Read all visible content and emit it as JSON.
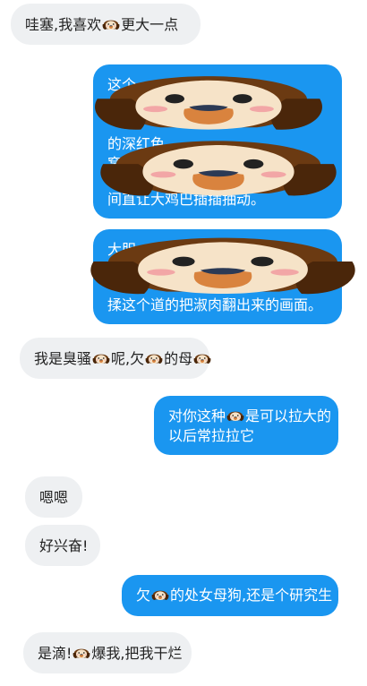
{
  "messages": [
    {
      "side": "left",
      "parts": [
        "哇塞,我喜欢",
        "更大一点"
      ]
    },
    {
      "side": "right",
      "lines": [
        "这个",
        "",
        "",
        "的深红色",
        "",
        "窝",
        "",
        "",
        "间直让大鸡巴插插抽动。"
      ]
    },
    {
      "side": "right",
      "lines": [
        "大胆",
        "",
        "",
        "揉这个道的把淑肉翻出来的画面。"
      ]
    },
    {
      "side": "left",
      "parts": [
        "我是臭骚",
        "呢,欠",
        "的母",
        ""
      ]
    },
    {
      "side": "right",
      "parts": [
        "对你这种",
        "是可以拉大的"
      ],
      "line2": "以后常拉拉它"
    },
    {
      "side": "left",
      "text": "嗯嗯"
    },
    {
      "side": "left",
      "text": "好兴奋!"
    },
    {
      "side": "right",
      "parts": [
        "欠",
        "的处女母狗,还是个研究生"
      ]
    },
    {
      "side": "left",
      "parts": [
        "是滴!",
        "爆我,把我干烂"
      ]
    }
  ],
  "icons": {
    "sticker": "puppy-face-icon"
  },
  "colors": {
    "outgoing": "#1a96f0",
    "incoming": "#eef0f2"
  }
}
